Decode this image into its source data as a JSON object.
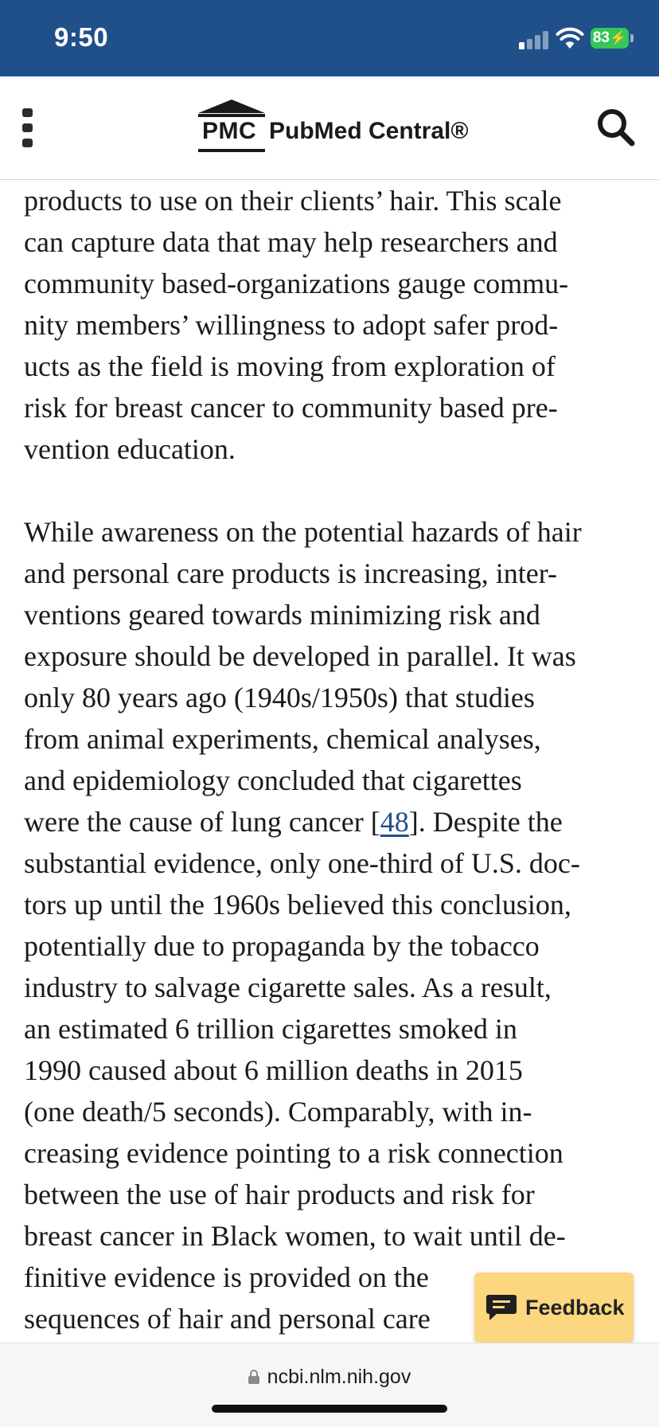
{
  "status_bar": {
    "time": "9:50",
    "battery": "83",
    "icons": [
      "signal-icon",
      "wifi-icon",
      "battery-charging-icon"
    ]
  },
  "header": {
    "logo_abbr": "PMC",
    "logo_text": "PubMed Central®",
    "icons": [
      "menu-icon",
      "search-icon"
    ]
  },
  "article": {
    "paragraph1": [
      "products to use on their clients’ hair. This scale",
      "can capture data that may help researchers and",
      "community based-organizations gauge commu-",
      "nity members’ willingness to adopt safer prod-",
      "ucts as the field is moving from exploration of",
      "risk for breast cancer to community based pre-",
      "vention education."
    ],
    "paragraph2": [
      "While awareness on the potential hazards of hair",
      "and personal care products is increasing, inter-",
      "ventions geared towards minimizing risk and",
      "exposure should be developed in parallel. It was",
      "only 80 years ago (1940s/1950s) that studies",
      "from animal experiments, chemical analyses,",
      "and epidemiology concluded that cigarettes"
    ],
    "ref_line": {
      "before": "were the cause of lung cancer [",
      "ref": "48",
      "after": "]. Despite the"
    },
    "paragraph2_rest": [
      "substantial evidence, only one-third of U.S. doc-",
      "tors up until the 1960s believed this conclusion,",
      "potentially due to propaganda by the tobacco",
      "industry to salvage cigarette sales. As a result,",
      "an estimated 6 trillion cigarettes smoked in",
      "1990 caused about 6 million deaths in 2015",
      "(one death/5 seconds). Comparably, with in-",
      "creasing evidence pointing to a risk connection",
      "between the use of hair products and risk for",
      "breast cancer in Black women, to wait until de-",
      "finitive evidence is provided on the",
      "sequences of hair and personal care"
    ]
  },
  "feedback": {
    "label": "Feedback",
    "bg_color": "#fcd77f"
  },
  "url_bar": {
    "domain": "ncbi.nlm.nih.gov"
  },
  "colors": {
    "status_bar": "#20508a",
    "link": "#20508a",
    "battery": "#35c759"
  }
}
